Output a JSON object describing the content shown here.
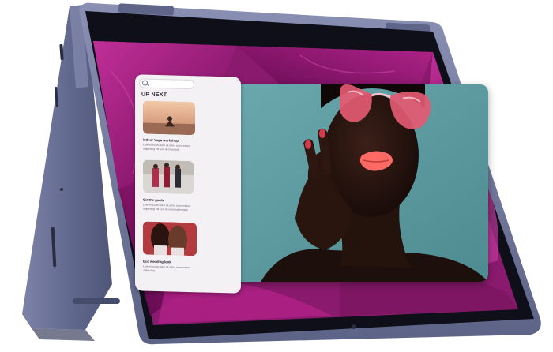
{
  "device": {
    "type": "2-in-1 laptop in tent mode",
    "body_color": "#6f7599",
    "bezel_color": "#0e0f18"
  },
  "screen": {
    "wallpaper": "magenta flower petals",
    "wallpaper_color": "#9c1f7c"
  },
  "side_panel": {
    "search_icon": "search-icon",
    "title": "UP NEXT",
    "cards": [
      {
        "title": "Indoor Yoga workshop",
        "text": "Lorem ipsum dolor sit amet consectetur adipiscing elit sed do eiusmod"
      },
      {
        "title": "Set the goals",
        "text": "Lorem ipsum dolor sit amet consectetur adipiscing elit sed do eiusmod tempor"
      },
      {
        "title": "Eco wedding look",
        "text": "Lorem ipsum dolor sit amet consectetur adipiscing"
      }
    ]
  },
  "photo_window": {
    "subject": "woman with red heart sunglasses",
    "background_color": "#5f9aa0"
  },
  "colors": {
    "accent": "#b2267f",
    "panel_bg": "#f3f1f4"
  }
}
